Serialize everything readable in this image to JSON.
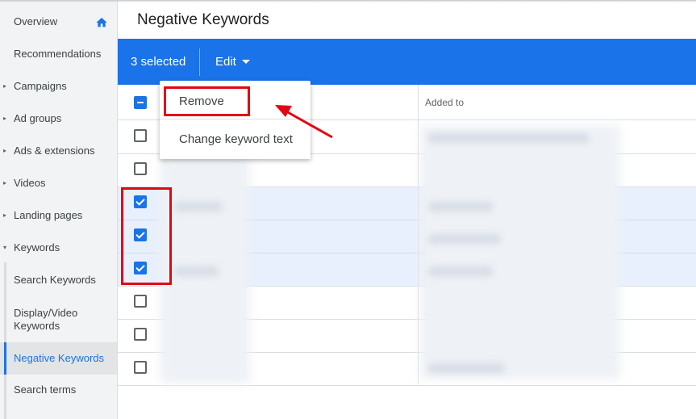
{
  "page": {
    "title": "Negative Keywords"
  },
  "sidebar": {
    "items": [
      {
        "label": "Overview",
        "caret": false
      },
      {
        "label": "Recommendations",
        "caret": false
      },
      {
        "label": "Campaigns",
        "caret": true
      },
      {
        "label": "Ad groups",
        "caret": true
      },
      {
        "label": "Ads & extensions",
        "caret": true
      },
      {
        "label": "Videos",
        "caret": true
      },
      {
        "label": "Landing pages",
        "caret": true
      },
      {
        "label": "Keywords",
        "caret": true,
        "expanded": true
      }
    ],
    "subitems": [
      {
        "label": "Search Keywords"
      },
      {
        "label": "Display/Video Keywords"
      },
      {
        "label": "Negative Keywords",
        "active": true
      },
      {
        "label": "Search terms"
      }
    ]
  },
  "toolbar": {
    "selected_text": "3 selected",
    "edit_label": "Edit"
  },
  "menu": {
    "items": [
      "Remove",
      "Change keyword text"
    ]
  },
  "table": {
    "columns": [
      "",
      "Added to"
    ],
    "rows": [
      {
        "checked": false
      },
      {
        "checked": false
      },
      {
        "checked": true
      },
      {
        "checked": true
      },
      {
        "checked": true
      },
      {
        "checked": false
      },
      {
        "checked": false
      },
      {
        "checked": false
      }
    ]
  },
  "colors": {
    "accent": "#1a73e8",
    "annotation": "#e30613",
    "selected_row": "#e8f0fe"
  }
}
